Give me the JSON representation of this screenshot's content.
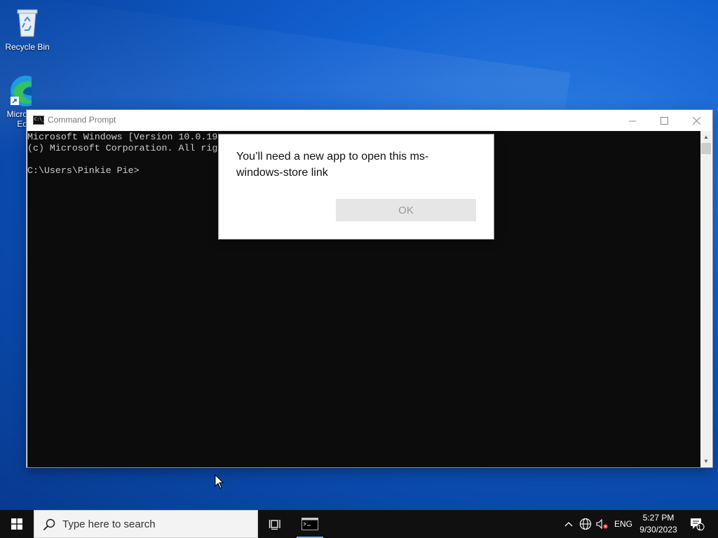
{
  "desktop": {
    "icons": [
      {
        "label": "Recycle Bin"
      },
      {
        "label": "Micro Ed"
      }
    ]
  },
  "cmd_window": {
    "title": "Command Prompt",
    "console_lines": [
      "Microsoft Windows [Version 10.0.19",
      "(c) Microsoft Corporation. All rig",
      "",
      "C:\\Users\\Pinkie Pie>"
    ]
  },
  "dialog": {
    "message": "You’ll need a new app to open this ms-windows-store link",
    "ok_label": "OK"
  },
  "taskbar": {
    "search_placeholder": "Type here to search",
    "language": "ENG",
    "time": "5:27 PM",
    "date": "9/30/2023",
    "notification_count": "1"
  }
}
